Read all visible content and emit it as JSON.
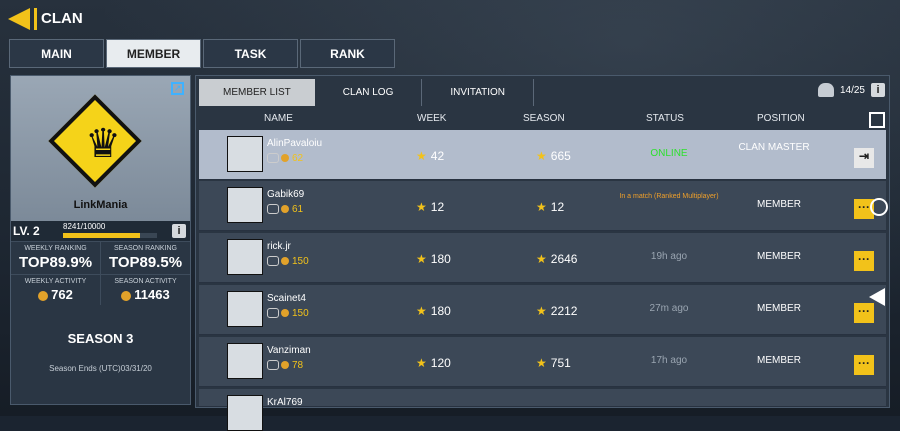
{
  "header": {
    "title": "CLAN"
  },
  "tabs": [
    "MAIN",
    "MEMBER",
    "TASK",
    "RANK"
  ],
  "clan": {
    "name": "LinkMania",
    "level": "LV. 2",
    "xp": "8241/10000",
    "xp_progress": 0.8241,
    "weekly_ranking_label": "WEEKLY RANKING",
    "weekly_ranking": "TOP89.9%",
    "season_ranking_label": "SEASON RANKING",
    "season_ranking": "TOP89.5%",
    "weekly_activity_label": "WEEKLY ACTIVITY",
    "weekly_activity": "762",
    "season_activity_label": "SEASON ACTIVITY",
    "season_activity": "11463",
    "season": "SEASON 3",
    "season_ends": "Season Ends (UTC)03/31/20"
  },
  "subtabs": [
    "MEMBER LIST",
    "CLAN LOG",
    "INVITATION"
  ],
  "member_count": "14/25",
  "columns": [
    "NAME",
    "WEEK",
    "SEASON",
    "STATUS",
    "POSITION"
  ],
  "members": [
    {
      "name": "AlinPavaloiu",
      "level": "62",
      "week": "42",
      "season": "665",
      "status": "ONLINE",
      "position": "CLAN MASTER",
      "status_color": "#2de02d"
    },
    {
      "name": "Gabik69",
      "level": "61",
      "week": "12",
      "season": "12",
      "status": "In a match (Ranked Multiplayer)",
      "position": "MEMBER",
      "status_color": "#f0a02a"
    },
    {
      "name": "rick.jr",
      "level": "150",
      "week": "180",
      "season": "2646",
      "status": "19h ago",
      "position": "MEMBER",
      "status_color": "#9aa5b1"
    },
    {
      "name": "Scainet4",
      "level": "150",
      "week": "180",
      "season": "2212",
      "status": "27m ago",
      "position": "MEMBER",
      "status_color": "#9aa5b1"
    },
    {
      "name": "Vanziman",
      "level": "78",
      "week": "120",
      "season": "751",
      "status": "17h ago",
      "position": "MEMBER",
      "status_color": "#9aa5b1"
    },
    {
      "name": "KrAl769",
      "level": "",
      "week": "",
      "season": "",
      "status": "",
      "position": "",
      "status_color": "#9aa5b1"
    }
  ],
  "colors": {
    "accent": "#f2c21a",
    "online": "#2de02d"
  }
}
